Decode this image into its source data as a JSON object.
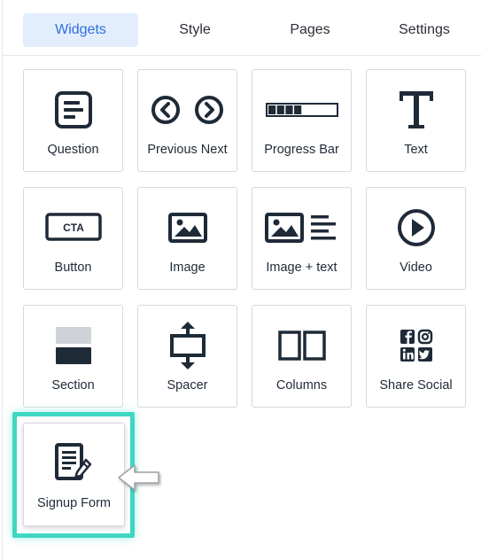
{
  "tabs": [
    {
      "label": "Widgets",
      "active": true
    },
    {
      "label": "Style",
      "active": false
    },
    {
      "label": "Pages",
      "active": false
    },
    {
      "label": "Settings",
      "active": false
    }
  ],
  "widgets": [
    {
      "label": "Question",
      "icon": "question-icon"
    },
    {
      "label": "Previous Next",
      "icon": "previous-next-icon"
    },
    {
      "label": "Progress Bar",
      "icon": "progress-bar-icon"
    },
    {
      "label": "Text",
      "icon": "text-icon"
    },
    {
      "label": "Button",
      "icon": "cta-button-icon",
      "icon_text": "CTA"
    },
    {
      "label": "Image",
      "icon": "image-icon"
    },
    {
      "label": "Image + text",
      "icon": "image-text-icon"
    },
    {
      "label": "Video",
      "icon": "video-play-icon"
    },
    {
      "label": "Section",
      "icon": "section-icon"
    },
    {
      "label": "Spacer",
      "icon": "spacer-icon"
    },
    {
      "label": "Columns",
      "icon": "columns-icon"
    },
    {
      "label": "Share Social",
      "icon": "share-social-icon"
    },
    {
      "label": "Signup Form",
      "icon": "signup-form-icon",
      "highlighted": true
    }
  ],
  "progress_bar_icon_fill": 0.55,
  "colors": {
    "active_tab_bg": "#e3eefc",
    "active_tab_text": "#2f6fe0",
    "icon_dark": "#1f2a37",
    "highlight": "#3fd6c2"
  }
}
